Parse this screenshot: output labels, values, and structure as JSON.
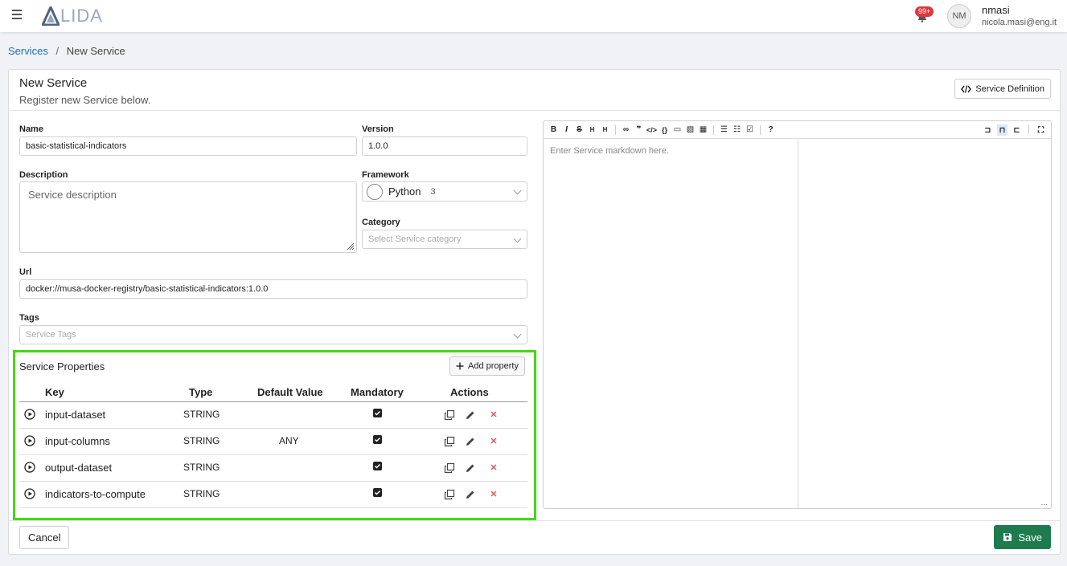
{
  "app": {
    "logo_text": "LIDA"
  },
  "header": {
    "notifications_count": "99+",
    "user_initials": "NM",
    "user_name": "nmasi",
    "user_email": "nicola.masi@eng.it"
  },
  "breadcrumb": {
    "parent": "Services",
    "separator": "/",
    "current": "New Service"
  },
  "page": {
    "title": "New Service",
    "subtitle": "Register new Service below.",
    "definition_button": "Service Definition"
  },
  "form": {
    "name_label": "Name",
    "name_value": "basic-statistical-indicators",
    "version_label": "Version",
    "version_value": "1.0.0",
    "description_label": "Description",
    "description_placeholder": "Service description",
    "framework_label": "Framework",
    "framework_value": "Python",
    "framework_version": "3",
    "category_label": "Category",
    "category_placeholder": "Select Service category",
    "url_label": "Url",
    "url_value": "docker://musa-docker-registry/basic-statistical-indicators:1.0.0",
    "tags_label": "Tags",
    "tags_placeholder": "Service Tags"
  },
  "properties": {
    "title": "Service Properties",
    "add_button": "Add property",
    "columns": [
      "Key",
      "Type",
      "Default Value",
      "Mandatory",
      "Actions"
    ],
    "rows": [
      {
        "key": "input-dataset",
        "type": "STRING",
        "default": "",
        "mandatory": true
      },
      {
        "key": "input-columns",
        "type": "STRING",
        "default": "ANY",
        "mandatory": true
      },
      {
        "key": "output-dataset",
        "type": "STRING",
        "default": "",
        "mandatory": true
      },
      {
        "key": "indicators-to-compute",
        "type": "STRING",
        "default": "",
        "mandatory": true
      }
    ]
  },
  "editor": {
    "placeholder": "Enter Service markdown here.",
    "toolbar": [
      "bold-icon",
      "italic-icon",
      "strikethrough-icon",
      "heading-icon",
      "heading-small-icon",
      "link-icon",
      "quote-icon",
      "code-icon",
      "code-block-icon",
      "comment-icon",
      "image-icon",
      "table-icon",
      "unordered-list-icon",
      "ordered-list-icon",
      "checklist-icon",
      "help-icon",
      "preview-edit-icon",
      "split-view-icon",
      "preview-icon",
      "fullscreen-icon"
    ]
  },
  "footer": {
    "cancel_label": "Cancel",
    "save_label": "Save"
  },
  "colors": {
    "accent": "#1b6ec2",
    "save": "#1e7b4d",
    "highlight": "#44d914",
    "delete": "#e25555",
    "badge": "#e2363f"
  }
}
